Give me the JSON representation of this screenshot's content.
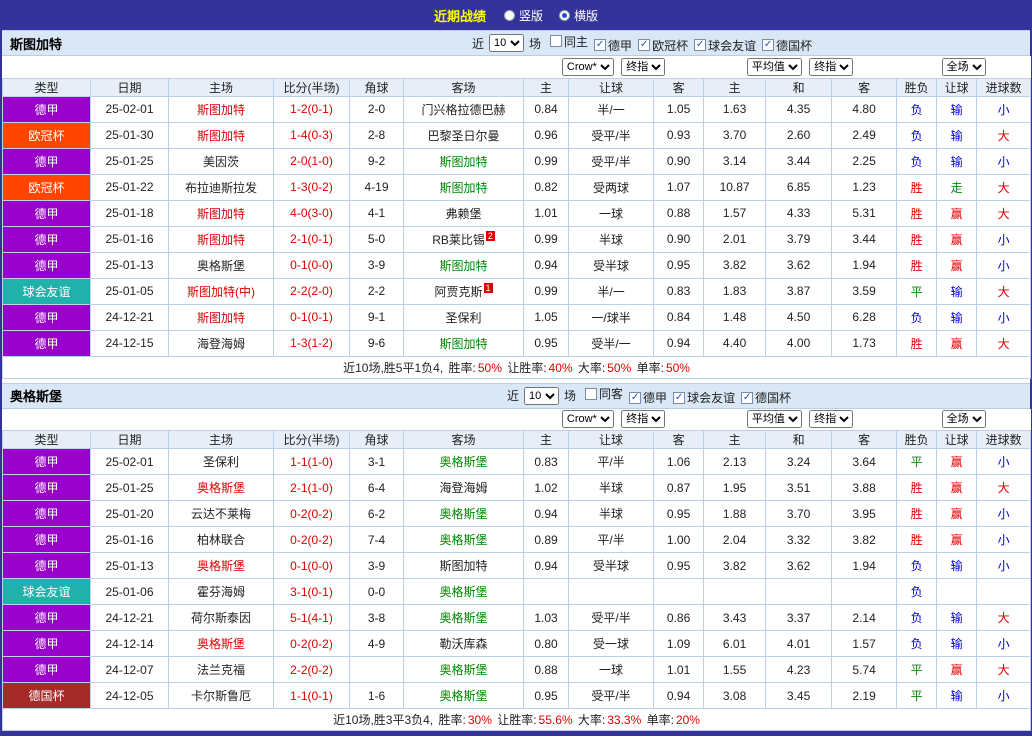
{
  "topbar": {
    "title": "近期战绩",
    "radios": [
      {
        "label": "竖版",
        "selected": false
      },
      {
        "label": "横版",
        "selected": true
      }
    ]
  },
  "palette": {
    "topbar_bg": "#333399",
    "title_yellow": "#FFFF00",
    "win_red": "#E00000",
    "draw_green": "#008800",
    "loss_blue": "#0000E0",
    "bundesliga_purple": "#9900CC",
    "ucl_orange": "#FF4500",
    "friendly_teal": "#20B2AA",
    "german_cup_brown": "#A52A2A",
    "header_bg": "#D9E7F7",
    "grid_line": "#BCD0E8"
  },
  "columns": {
    "type": "类型",
    "date": "日期",
    "home": "主场",
    "score": "比分(半场)",
    "corner": "角球",
    "away": "客场",
    "odds_home": "主",
    "odds_line": "让球",
    "odds_away": "客",
    "avg_home": "主",
    "avg_draw": "和",
    "avg_away": "客",
    "res_outcome": "胜负",
    "res_handicap": "让球",
    "res_goals": "进球数"
  },
  "sections": [
    {
      "team": "斯图加特",
      "near_label": "近",
      "recent_count": "10",
      "matches_label": "场",
      "filters": [
        {
          "label": "同主",
          "checked": false
        },
        {
          "label": "德甲",
          "checked": true
        },
        {
          "label": "欧冠杯",
          "checked": true
        },
        {
          "label": "球会友谊",
          "checked": true
        },
        {
          "label": "德国杯",
          "checked": true
        }
      ],
      "selects": {
        "bookmaker": "Crow*",
        "book_stage": "终指",
        "avg": "平均值",
        "avg_stage": "终指",
        "scope": "全场"
      },
      "rows": [
        {
          "type": {
            "text": "德甲",
            "bg": "#9900CC"
          },
          "date": "25-02-01",
          "home": {
            "text": "斯图加特",
            "color": "red"
          },
          "score": "1-2(0-1)",
          "corner": "2-0",
          "away": {
            "text": "门兴格拉德巴赫",
            "color": "black"
          },
          "odds_home": "0.84",
          "odds_line": "半/一",
          "odds_away": "1.05",
          "avg_home": "1.63",
          "avg_draw": "4.35",
          "avg_away": "4.80",
          "res_outcome": {
            "text": "负",
            "color": "blue"
          },
          "res_handicap": {
            "text": "输",
            "color": "blue"
          },
          "res_goals": {
            "text": "小",
            "color": "blue"
          }
        },
        {
          "type": {
            "text": "欧冠杯",
            "bg": "#FF4500"
          },
          "date": "25-01-30",
          "home": {
            "text": "斯图加特",
            "color": "red"
          },
          "score": "1-4(0-3)",
          "corner": "2-8",
          "away": {
            "text": "巴黎圣日尔曼",
            "color": "black"
          },
          "odds_home": "0.96",
          "odds_line": "受平/半",
          "odds_away": "0.93",
          "avg_home": "3.70",
          "avg_draw": "2.60",
          "avg_away": "2.49",
          "res_outcome": {
            "text": "负",
            "color": "blue"
          },
          "res_handicap": {
            "text": "输",
            "color": "blue"
          },
          "res_goals": {
            "text": "大",
            "color": "red"
          }
        },
        {
          "type": {
            "text": "德甲",
            "bg": "#9900CC"
          },
          "date": "25-01-25",
          "home": {
            "text": "美因茨",
            "color": "black"
          },
          "score": "2-0(1-0)",
          "corner": "9-2",
          "away": {
            "text": "斯图加特",
            "color": "green"
          },
          "odds_home": "0.99",
          "odds_line": "受平/半",
          "odds_away": "0.90",
          "avg_home": "3.14",
          "avg_draw": "3.44",
          "avg_away": "2.25",
          "res_outcome": {
            "text": "负",
            "color": "blue"
          },
          "res_handicap": {
            "text": "输",
            "color": "blue"
          },
          "res_goals": {
            "text": "小",
            "color": "blue"
          }
        },
        {
          "type": {
            "text": "欧冠杯",
            "bg": "#FF4500"
          },
          "date": "25-01-22",
          "home": {
            "text": "布拉迪斯拉发",
            "color": "black"
          },
          "score": "1-3(0-2)",
          "corner": "4-19",
          "away": {
            "text": "斯图加特",
            "color": "green"
          },
          "odds_home": "0.82",
          "odds_line": "受两球",
          "odds_away": "1.07",
          "avg_home": "10.87",
          "avg_draw": "6.85",
          "avg_away": "1.23",
          "res_outcome": {
            "text": "胜",
            "color": "red"
          },
          "res_handicap": {
            "text": "走",
            "color": "green"
          },
          "res_goals": {
            "text": "大",
            "color": "red"
          }
        },
        {
          "type": {
            "text": "德甲",
            "bg": "#9900CC"
          },
          "date": "25-01-18",
          "home": {
            "text": "斯图加特",
            "color": "red"
          },
          "score": "4-0(3-0)",
          "corner": "4-1",
          "away": {
            "text": "弗赖堡",
            "color": "black"
          },
          "odds_home": "1.01",
          "odds_line": "一球",
          "odds_away": "0.88",
          "avg_home": "1.57",
          "avg_draw": "4.33",
          "avg_away": "5.31",
          "res_outcome": {
            "text": "胜",
            "color": "red"
          },
          "res_handicap": {
            "text": "赢",
            "color": "red"
          },
          "res_goals": {
            "text": "大",
            "color": "red"
          }
        },
        {
          "type": {
            "text": "德甲",
            "bg": "#9900CC"
          },
          "date": "25-01-16",
          "home": {
            "text": "斯图加特",
            "color": "red"
          },
          "score": "2-1(0-1)",
          "corner": "5-0",
          "away": {
            "text": "RB莱比锡",
            "color": "black",
            "sup": "2"
          },
          "odds_home": "0.99",
          "odds_line": "半球",
          "odds_away": "0.90",
          "avg_home": "2.01",
          "avg_draw": "3.79",
          "avg_away": "3.44",
          "res_outcome": {
            "text": "胜",
            "color": "red"
          },
          "res_handicap": {
            "text": "赢",
            "color": "red"
          },
          "res_goals": {
            "text": "小",
            "color": "blue"
          }
        },
        {
          "type": {
            "text": "德甲",
            "bg": "#9900CC"
          },
          "date": "25-01-13",
          "home": {
            "text": "奥格斯堡",
            "color": "black"
          },
          "score": "0-1(0-0)",
          "corner": "3-9",
          "away": {
            "text": "斯图加特",
            "color": "green"
          },
          "odds_home": "0.94",
          "odds_line": "受半球",
          "odds_away": "0.95",
          "avg_home": "3.82",
          "avg_draw": "3.62",
          "avg_away": "1.94",
          "res_outcome": {
            "text": "胜",
            "color": "red"
          },
          "res_handicap": {
            "text": "赢",
            "color": "red"
          },
          "res_goals": {
            "text": "小",
            "color": "blue"
          }
        },
        {
          "type": {
            "text": "球会友谊",
            "bg": "#20B2AA"
          },
          "date": "25-01-05",
          "home": {
            "text": "斯图加特(中)",
            "color": "red"
          },
          "score": "2-2(2-0)",
          "corner": "2-2",
          "away": {
            "text": "阿贾克斯",
            "color": "black",
            "sup": "1"
          },
          "odds_home": "0.99",
          "odds_line": "半/一",
          "odds_away": "0.83",
          "avg_home": "1.83",
          "avg_draw": "3.87",
          "avg_away": "3.59",
          "res_outcome": {
            "text": "平",
            "color": "green"
          },
          "res_handicap": {
            "text": "输",
            "color": "blue"
          },
          "res_goals": {
            "text": "大",
            "color": "red"
          }
        },
        {
          "type": {
            "text": "德甲",
            "bg": "#9900CC"
          },
          "date": "24-12-21",
          "home": {
            "text": "斯图加特",
            "color": "red"
          },
          "score": "0-1(0-1)",
          "corner": "9-1",
          "away": {
            "text": "圣保利",
            "color": "black"
          },
          "odds_home": "1.05",
          "odds_line": "一/球半",
          "odds_away": "0.84",
          "avg_home": "1.48",
          "avg_draw": "4.50",
          "avg_away": "6.28",
          "res_outcome": {
            "text": "负",
            "color": "blue"
          },
          "res_handicap": {
            "text": "输",
            "color": "blue"
          },
          "res_goals": {
            "text": "小",
            "color": "blue"
          }
        },
        {
          "type": {
            "text": "德甲",
            "bg": "#9900CC"
          },
          "date": "24-12-15",
          "home": {
            "text": "海登海姆",
            "color": "black"
          },
          "score": "1-3(1-2)",
          "corner": "9-6",
          "away": {
            "text": "斯图加特",
            "color": "green"
          },
          "odds_home": "0.95",
          "odds_line": "受半/一",
          "odds_away": "0.94",
          "avg_home": "4.40",
          "avg_draw": "4.00",
          "avg_away": "1.73",
          "res_outcome": {
            "text": "胜",
            "color": "red"
          },
          "res_handicap": {
            "text": "赢",
            "color": "red"
          },
          "res_goals": {
            "text": "大",
            "color": "red"
          }
        }
      ],
      "summary": {
        "prefix": "近10场,胜5平1负4,",
        "stats": [
          {
            "label": "胜率:",
            "value": "50%"
          },
          {
            "label": "让胜率:",
            "value": "40%"
          },
          {
            "label": "大率:",
            "value": "50%"
          },
          {
            "label": "单率:",
            "value": "50%"
          }
        ]
      }
    },
    {
      "team": "奥格斯堡",
      "near_label": "近",
      "recent_count": "10",
      "matches_label": "场",
      "filters": [
        {
          "label": "同客",
          "checked": false
        },
        {
          "label": "德甲",
          "checked": true
        },
        {
          "label": "球会友谊",
          "checked": true
        },
        {
          "label": "德国杯",
          "checked": true
        }
      ],
      "selects": {
        "bookmaker": "Crow*",
        "book_stage": "终指",
        "avg": "平均值",
        "avg_stage": "终指",
        "scope": "全场"
      },
      "rows": [
        {
          "type": {
            "text": "德甲",
            "bg": "#9900CC"
          },
          "date": "25-02-01",
          "home": {
            "text": "圣保利",
            "color": "black"
          },
          "score": "1-1(1-0)",
          "corner": "3-1",
          "away": {
            "text": "奥格斯堡",
            "color": "green"
          },
          "odds_home": "0.83",
          "odds_line": "平/半",
          "odds_away": "1.06",
          "avg_home": "2.13",
          "avg_draw": "3.24",
          "avg_away": "3.64",
          "res_outcome": {
            "text": "平",
            "color": "green"
          },
          "res_handicap": {
            "text": "赢",
            "color": "red"
          },
          "res_goals": {
            "text": "小",
            "color": "blue"
          }
        },
        {
          "type": {
            "text": "德甲",
            "bg": "#9900CC"
          },
          "date": "25-01-25",
          "home": {
            "text": "奥格斯堡",
            "color": "red"
          },
          "score": "2-1(1-0)",
          "corner": "6-4",
          "away": {
            "text": "海登海姆",
            "color": "black"
          },
          "odds_home": "1.02",
          "odds_line": "半球",
          "odds_away": "0.87",
          "avg_home": "1.95",
          "avg_draw": "3.51",
          "avg_away": "3.88",
          "res_outcome": {
            "text": "胜",
            "color": "red"
          },
          "res_handicap": {
            "text": "赢",
            "color": "red"
          },
          "res_goals": {
            "text": "大",
            "color": "red"
          }
        },
        {
          "type": {
            "text": "德甲",
            "bg": "#9900CC"
          },
          "date": "25-01-20",
          "home": {
            "text": "云达不莱梅",
            "color": "black"
          },
          "score": "0-2(0-2)",
          "corner": "6-2",
          "away": {
            "text": "奥格斯堡",
            "color": "green"
          },
          "odds_home": "0.94",
          "odds_line": "半球",
          "odds_away": "0.95",
          "avg_home": "1.88",
          "avg_draw": "3.70",
          "avg_away": "3.95",
          "res_outcome": {
            "text": "胜",
            "color": "red"
          },
          "res_handicap": {
            "text": "赢",
            "color": "red"
          },
          "res_goals": {
            "text": "小",
            "color": "blue"
          }
        },
        {
          "type": {
            "text": "德甲",
            "bg": "#9900CC"
          },
          "date": "25-01-16",
          "home": {
            "text": "柏林联合",
            "color": "black"
          },
          "score": "0-2(0-2)",
          "corner": "7-4",
          "away": {
            "text": "奥格斯堡",
            "color": "green"
          },
          "odds_home": "0.89",
          "odds_line": "平/半",
          "odds_away": "1.00",
          "avg_home": "2.04",
          "avg_draw": "3.32",
          "avg_away": "3.82",
          "res_outcome": {
            "text": "胜",
            "color": "red"
          },
          "res_handicap": {
            "text": "赢",
            "color": "red"
          },
          "res_goals": {
            "text": "小",
            "color": "blue"
          }
        },
        {
          "type": {
            "text": "德甲",
            "bg": "#9900CC"
          },
          "date": "25-01-13",
          "home": {
            "text": "奥格斯堡",
            "color": "red"
          },
          "score": "0-1(0-0)",
          "corner": "3-9",
          "away": {
            "text": "斯图加特",
            "color": "black"
          },
          "odds_home": "0.94",
          "odds_line": "受半球",
          "odds_away": "0.95",
          "avg_home": "3.82",
          "avg_draw": "3.62",
          "avg_away": "1.94",
          "res_outcome": {
            "text": "负",
            "color": "blue"
          },
          "res_handicap": {
            "text": "输",
            "color": "blue"
          },
          "res_goals": {
            "text": "小",
            "color": "blue"
          }
        },
        {
          "type": {
            "text": "球会友谊",
            "bg": "#20B2AA"
          },
          "date": "25-01-06",
          "home": {
            "text": "霍芬海姆",
            "color": "black"
          },
          "score": "3-1(0-1)",
          "corner": "0-0",
          "away": {
            "text": "奥格斯堡",
            "color": "green"
          },
          "odds_home": "",
          "odds_line": "",
          "odds_away": "",
          "avg_home": "",
          "avg_draw": "",
          "avg_away": "",
          "res_outcome": {
            "text": "负",
            "color": "blue"
          },
          "res_handicap": "",
          "res_goals": ""
        },
        {
          "type": {
            "text": "德甲",
            "bg": "#9900CC"
          },
          "date": "24-12-21",
          "home": {
            "text": "荷尔斯泰因",
            "color": "black"
          },
          "score": "5-1(4-1)",
          "corner": "3-8",
          "away": {
            "text": "奥格斯堡",
            "color": "green"
          },
          "odds_home": "1.03",
          "odds_line": "受平/半",
          "odds_away": "0.86",
          "avg_home": "3.43",
          "avg_draw": "3.37",
          "avg_away": "2.14",
          "res_outcome": {
            "text": "负",
            "color": "blue"
          },
          "res_handicap": {
            "text": "输",
            "color": "blue"
          },
          "res_goals": {
            "text": "大",
            "color": "red"
          }
        },
        {
          "type": {
            "text": "德甲",
            "bg": "#9900CC"
          },
          "date": "24-12-14",
          "home": {
            "text": "奥格斯堡",
            "color": "red"
          },
          "score": "0-2(0-2)",
          "corner": "4-9",
          "away": {
            "text": "勒沃库森",
            "color": "black"
          },
          "odds_home": "0.80",
          "odds_line": "受一球",
          "odds_away": "1.09",
          "avg_home": "6.01",
          "avg_draw": "4.01",
          "avg_away": "1.57",
          "res_outcome": {
            "text": "负",
            "color": "blue"
          },
          "res_handicap": {
            "text": "输",
            "color": "blue"
          },
          "res_goals": {
            "text": "小",
            "color": "blue"
          }
        },
        {
          "type": {
            "text": "德甲",
            "bg": "#9900CC"
          },
          "date": "24-12-07",
          "home": {
            "text": "法兰克福",
            "color": "black"
          },
          "score": "2-2(0-2)",
          "corner": "",
          "away": {
            "text": "奥格斯堡",
            "color": "green"
          },
          "odds_home": "0.88",
          "odds_line": "一球",
          "odds_away": "1.01",
          "avg_home": "1.55",
          "avg_draw": "4.23",
          "avg_away": "5.74",
          "res_outcome": {
            "text": "平",
            "color": "green"
          },
          "res_handicap": {
            "text": "赢",
            "color": "red"
          },
          "res_goals": {
            "text": "大",
            "color": "red"
          }
        },
        {
          "type": {
            "text": "德国杯",
            "bg": "#A52A2A"
          },
          "date": "24-12-05",
          "home": {
            "text": "卡尔斯鲁厄",
            "color": "black"
          },
          "score": "1-1(0-1)",
          "corner": "1-6",
          "away": {
            "text": "奥格斯堡",
            "color": "green"
          },
          "odds_home": "0.95",
          "odds_line": "受平/半",
          "odds_away": "0.94",
          "avg_home": "3.08",
          "avg_draw": "3.45",
          "avg_away": "2.19",
          "res_outcome": {
            "text": "平",
            "color": "green"
          },
          "res_handicap": {
            "text": "输",
            "color": "blue"
          },
          "res_goals": {
            "text": "小",
            "color": "blue"
          }
        }
      ],
      "summary": {
        "prefix": "近10场,胜3平3负4,",
        "stats": [
          {
            "label": "胜率:",
            "value": "30%"
          },
          {
            "label": "让胜率:",
            "value": "55.6%"
          },
          {
            "label": "大率:",
            "value": "33.3%"
          },
          {
            "label": "单率:",
            "value": "20%"
          }
        ]
      }
    }
  ]
}
